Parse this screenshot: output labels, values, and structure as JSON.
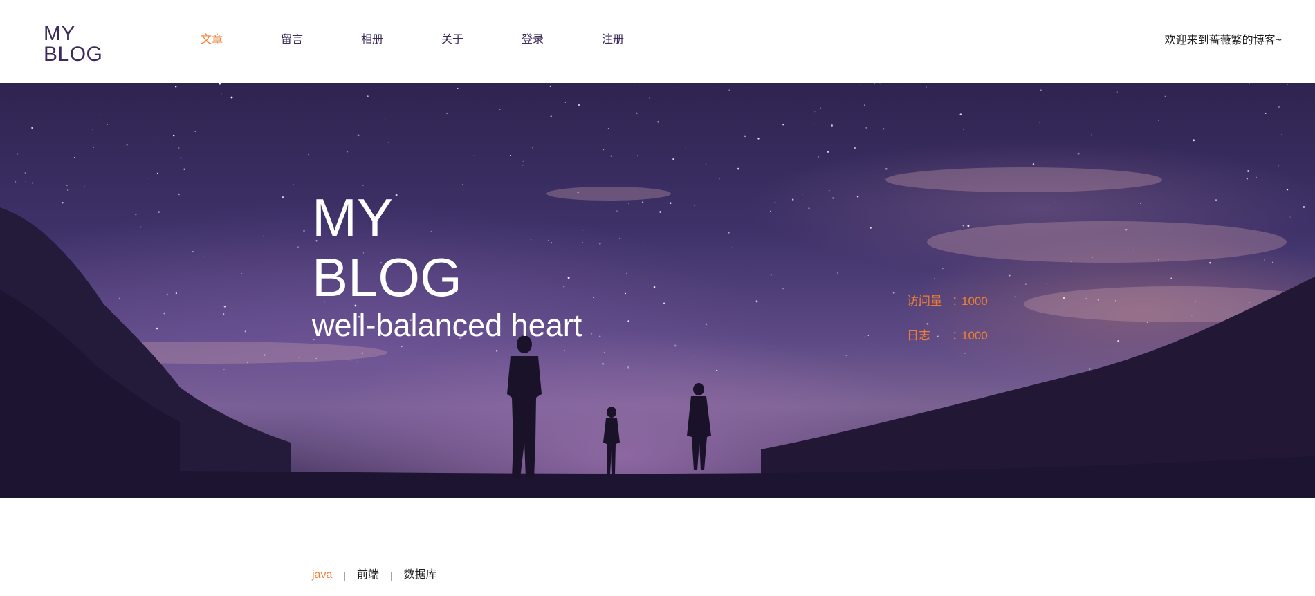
{
  "logo": {
    "line1": "MY",
    "line2": "BLOG"
  },
  "nav": {
    "items": [
      {
        "label": "文章",
        "active": true
      },
      {
        "label": "留言",
        "active": false
      },
      {
        "label": "相册",
        "active": false
      },
      {
        "label": "关于",
        "active": false
      },
      {
        "label": "登录",
        "active": false
      },
      {
        "label": "注册",
        "active": false
      }
    ]
  },
  "welcome": "欢迎来到蔷薇繁的博客~",
  "hero": {
    "title_line1": "MY",
    "title_line2": "BLOG",
    "subtitle": "well-balanced heart"
  },
  "stats": [
    {
      "label": "访问量",
      "sep": "：",
      "value": "1000"
    },
    {
      "label": "日志",
      "sep": "：",
      "value": "1000"
    }
  ],
  "categories": [
    {
      "label": "java",
      "active": true
    },
    {
      "label": "前端",
      "active": false
    },
    {
      "label": "数据库",
      "active": false
    }
  ],
  "colors": {
    "accent": "#f07d32",
    "brand": "#3b2a5a",
    "text": "#1e1e1e"
  }
}
